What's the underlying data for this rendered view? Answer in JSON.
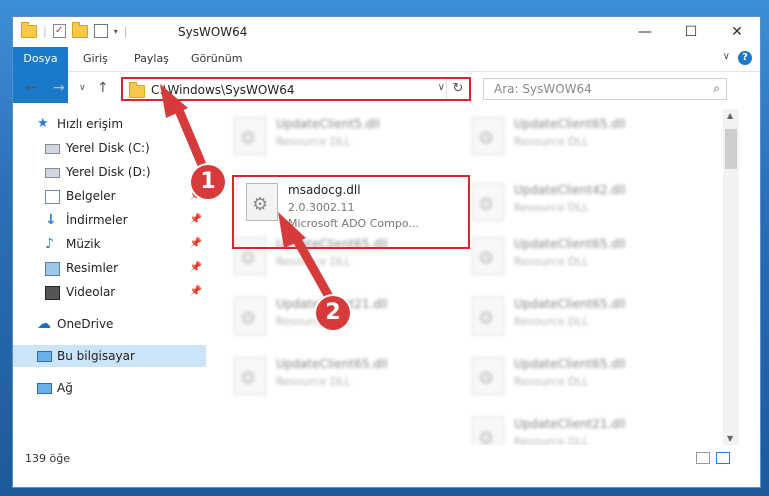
{
  "window": {
    "title": "SysWOW64",
    "minimize": "—",
    "maximize": "☐",
    "close": "✕"
  },
  "ribbon": {
    "tabs": [
      "Dosya",
      "Giriş",
      "Paylaş",
      "Görünüm"
    ],
    "help": "?"
  },
  "nav": {
    "address": "C:\\Windows\\SysWOW64",
    "search_placeholder": "Ara: SysWOW64"
  },
  "sidebar": {
    "items": [
      {
        "label": "Hızlı erişim",
        "icon": "star-icon",
        "pinned": false
      },
      {
        "label": "Yerel Disk (C:)",
        "icon": "drive-icon",
        "pinned": false
      },
      {
        "label": "Yerel Disk (D:)",
        "icon": "drive-icon",
        "pinned": false
      },
      {
        "label": "Belgeler",
        "icon": "documents-icon",
        "pinned": true
      },
      {
        "label": "İndirmeler",
        "icon": "download-icon",
        "pinned": true
      },
      {
        "label": "Müzik",
        "icon": "music-icon",
        "pinned": true
      },
      {
        "label": "Resimler",
        "icon": "pictures-icon",
        "pinned": true
      },
      {
        "label": "Videolar",
        "icon": "video-icon",
        "pinned": true
      },
      {
        "label": "OneDrive",
        "icon": "cloud-icon",
        "pinned": false
      },
      {
        "label": "Bu bilgisayar",
        "icon": "computer-icon",
        "pinned": false
      },
      {
        "label": "Ağ",
        "icon": "network-icon",
        "pinned": false
      }
    ]
  },
  "files": {
    "highlighted": {
      "name": "msadocg.dll",
      "version": "2.0.3002.11",
      "description": "Microsoft ADO Compo..."
    },
    "blurred": [
      {
        "name": "UpdateClient5.dll",
        "type": "Resource DLL"
      },
      {
        "name": "UpdateClient65.dll",
        "type": "Resource DLL"
      },
      {
        "name": "UpdateClient42.dll",
        "type": "Resource DLL"
      },
      {
        "name": "UpdateClient65.dll",
        "type": "Resource DLL"
      },
      {
        "name": "UpdateClient65.dll",
        "type": "Resource DLL"
      },
      {
        "name": "UpdateClient21.dll",
        "type": "Resource DLL"
      },
      {
        "name": "UpdateClient65.dll",
        "type": "Resource DLL"
      },
      {
        "name": "UpdateClient65.dll",
        "type": "Resource DLL"
      },
      {
        "name": "UpdateClient65.dll",
        "type": "Resource DLL"
      },
      {
        "name": "UpdateClient21.dll",
        "type": "Resource DLL"
      }
    ]
  },
  "status": {
    "count": "139 öğe"
  },
  "annotations": {
    "step1": "1",
    "step2": "2",
    "color": "#d63a3a"
  }
}
